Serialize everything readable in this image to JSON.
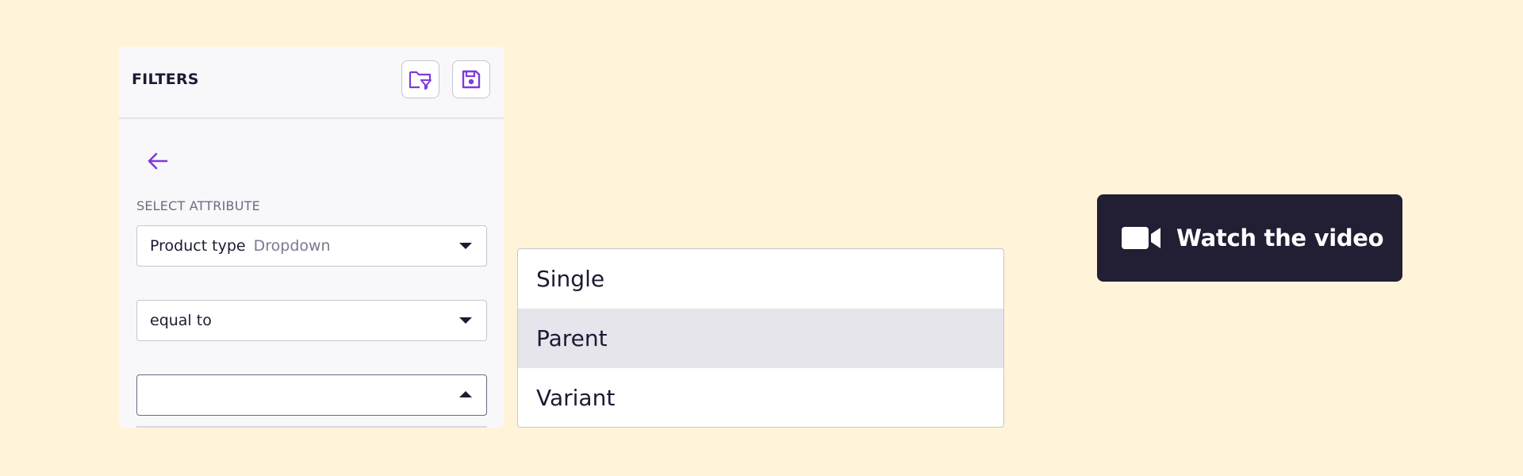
{
  "colors": {
    "background": "#FFF4D9",
    "accent": "#7E3BD8",
    "dark": "#221E34"
  },
  "filters": {
    "title": "FILTERS",
    "icons": [
      "folder-filter-icon",
      "save-icon"
    ],
    "back_icon": "arrow-left-icon",
    "section_label": "SELECT ATTRIBUTE",
    "attribute_select": {
      "value": "Product type",
      "type": "Dropdown"
    },
    "condition_select": {
      "value": "equal to"
    },
    "value_select": {
      "value": "",
      "open": true
    }
  },
  "dropdown": {
    "options": [
      "Single",
      "Parent",
      "Variant"
    ],
    "highlighted": "Parent"
  },
  "video_button": {
    "label": "Watch the video",
    "icon": "video-camera-icon"
  }
}
